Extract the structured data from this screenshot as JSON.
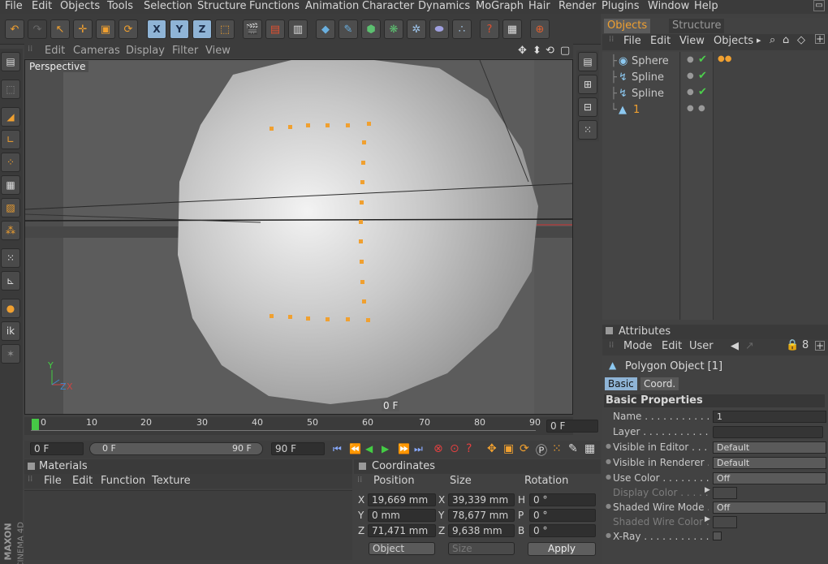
{
  "menu": [
    "File",
    "Edit",
    "Objects",
    "Tools",
    "Selection",
    "Structure",
    "Functions",
    "Animation",
    "Character",
    "Dynamics",
    "MoGraph",
    "Hair",
    "Render",
    "Plugins",
    "Window",
    "Help"
  ],
  "toolbar_axis": {
    "x": "X",
    "y": "Y",
    "z": "Z"
  },
  "viewport": {
    "menu": [
      "Edit",
      "Cameras",
      "Display",
      "Filter",
      "View"
    ],
    "label": "Perspective",
    "frame": "0 F",
    "axis_labels": {
      "y": "Y",
      "z": "Z",
      "x": "X"
    }
  },
  "timeline": {
    "ticks": [
      "0",
      "10",
      "20",
      "30",
      "40",
      "50",
      "60",
      "70",
      "80",
      "90"
    ],
    "frame_field": "0 F",
    "start": "0 F",
    "range_start": "0 F",
    "range_end": "90 F",
    "end": "90 F"
  },
  "objects_panel": {
    "tabs": [
      "Objects",
      "Structure"
    ],
    "menu": [
      "File",
      "Edit",
      "View",
      "Objects"
    ],
    "items": [
      {
        "name": "Sphere",
        "checked": true
      },
      {
        "name": "Spline",
        "checked": true
      },
      {
        "name": "Spline",
        "checked": true
      },
      {
        "name": "1",
        "checked": false
      }
    ]
  },
  "attributes": {
    "title": "Attributes",
    "menu": [
      "Mode",
      "Edit",
      "User"
    ],
    "object_title": "Polygon Object [1]",
    "tabs": [
      "Basic",
      "Coord."
    ],
    "section": "Basic Properties",
    "rows": [
      {
        "label": "Name",
        "value": "1",
        "dim": false
      },
      {
        "label": "Layer",
        "value": "",
        "dim": false
      },
      {
        "label": "Visible in Editor",
        "value": "Default",
        "dim": false
      },
      {
        "label": "Visible in Renderer",
        "value": "Default",
        "dim": false
      },
      {
        "label": "Use Color",
        "value": "Off",
        "dim": false
      },
      {
        "label": "Display Color",
        "value": "",
        "dim": true
      },
      {
        "label": "Shaded Wire Mode",
        "value": "Off",
        "dim": false
      },
      {
        "label": "Shaded Wire Color",
        "value": "",
        "dim": true
      },
      {
        "label": "X-Ray",
        "value": "",
        "dim": false
      }
    ]
  },
  "materials": {
    "title": "Materials",
    "menu": [
      "File",
      "Edit",
      "Function",
      "Texture"
    ]
  },
  "coordinates": {
    "title": "Coordinates",
    "headers": [
      "Position",
      "Size",
      "Rotation"
    ],
    "rows": [
      {
        "axis": "X",
        "pos": "19,669 mm",
        "saxis": "X",
        "size": "39,339 mm",
        "raxis": "H",
        "rot": "0 °"
      },
      {
        "axis": "Y",
        "pos": "0 mm",
        "saxis": "Y",
        "size": "78,677 mm",
        "raxis": "P",
        "rot": "0 °"
      },
      {
        "axis": "Z",
        "pos": "71,471 mm",
        "saxis": "Z",
        "size": "9,638 mm",
        "raxis": "B",
        "rot": "0 °"
      }
    ],
    "mode": "Object",
    "size_mode": "Size",
    "apply": "Apply"
  },
  "branding": {
    "line1": "MAXON",
    "line2": "CINEMA 4D"
  },
  "colors": {
    "accent_orange": "#f0a030",
    "selection_blue": "#8fb4d6",
    "check_green": "#4cd04c"
  }
}
